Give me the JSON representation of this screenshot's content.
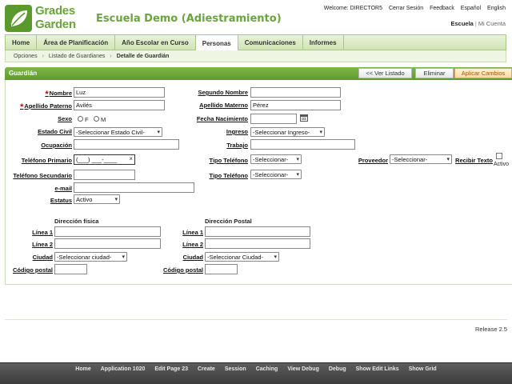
{
  "header": {
    "logo_line1": "Grades",
    "logo_line2": "Garden",
    "app_title": "Escuela Demo (Adiestramiento)",
    "welcome": "Welcome: DIRECTOR5",
    "links": [
      "Cerrar Sesión",
      "Feedback",
      "Español",
      "English"
    ],
    "school": "Escuela",
    "account": "Mi Cuenta"
  },
  "tabs": [
    {
      "label": "Home",
      "active": false
    },
    {
      "label": "Área de Planificación",
      "active": false
    },
    {
      "label": "Año Escolar en Curso",
      "active": false
    },
    {
      "label": "Personas",
      "active": true
    },
    {
      "label": "Comunicaciones",
      "active": false
    },
    {
      "label": "Informes",
      "active": false
    }
  ],
  "breadcrumb": [
    "Opciones",
    "Listado de Guardianes",
    "Detalle de Guardián"
  ],
  "region": {
    "title": "Guardián",
    "buttons": {
      "list": "<< Ver Listado",
      "delete": "Eliminar",
      "apply": "Aplicar Cambios"
    }
  },
  "form": {
    "nombre": {
      "label": "Nombre",
      "value": "Luz"
    },
    "segundo_nombre": {
      "label": "Segundo Nombre",
      "value": ""
    },
    "apellido_paterno": {
      "label": "Apellido Paterno",
      "value": "Avilés"
    },
    "apellido_materno": {
      "label": "Apellido Materno",
      "value": "Pérez"
    },
    "sexo": {
      "label": "Sexo",
      "opt_f": "F",
      "opt_m": "M"
    },
    "fecha_nacimiento": {
      "label": "Fecha Nacimiento",
      "value": ""
    },
    "estado_civil": {
      "label": "Estado Civil",
      "value": "-Seleccionar Estado Civil-"
    },
    "ingreso": {
      "label": "Ingreso",
      "value": "-Seleccionar Ingreso-"
    },
    "ocupacion": {
      "label": "Ocupación",
      "value": ""
    },
    "trabajo": {
      "label": "Trabajo",
      "value": ""
    },
    "telefono_primario": {
      "label": "Teléfono Primario",
      "value": "(___) ___-____",
      "clear": "×"
    },
    "tipo_telefono_1": {
      "label": "Tipo Teléfono",
      "value": "-Seleccionar-"
    },
    "proveedor": {
      "label": "Proveedor",
      "value": "-Seleccionar-"
    },
    "recibir_texto": {
      "label": "Recibir Texto",
      "check_label": "Activo"
    },
    "telefono_secundario": {
      "label": "Teléfono Secundario",
      "value": ""
    },
    "tipo_telefono_2": {
      "label": "Tipo Teléfono",
      "value": "-Seleccionar-"
    },
    "email": {
      "label": "e-mail",
      "value": ""
    },
    "estatus": {
      "label": "Estatus",
      "value": "Activo"
    }
  },
  "address": {
    "fisica_title": "Dirección física",
    "postal_title": "Dirección Postal",
    "linea1": "Línea 1",
    "linea2": "Línea 2",
    "ciudad": "Ciudad",
    "codigo_postal": "Código postal",
    "ciudad_fisica_value": "-Seleccionar ciudad-",
    "ciudad_postal_value": "-Seleccionar Ciudad-"
  },
  "release": "Release 2.5",
  "devbar": [
    "Home",
    "Application 1020",
    "Edit Page 23",
    "Create",
    "Session",
    "Caching",
    "View Debug",
    "Debug",
    "Show Edit Links",
    "Show Grid"
  ],
  "colors": {
    "brand": "#6aa53b",
    "region": "#5e9a2c",
    "required": "#cc0000",
    "apply_text": "#a05a0a"
  }
}
